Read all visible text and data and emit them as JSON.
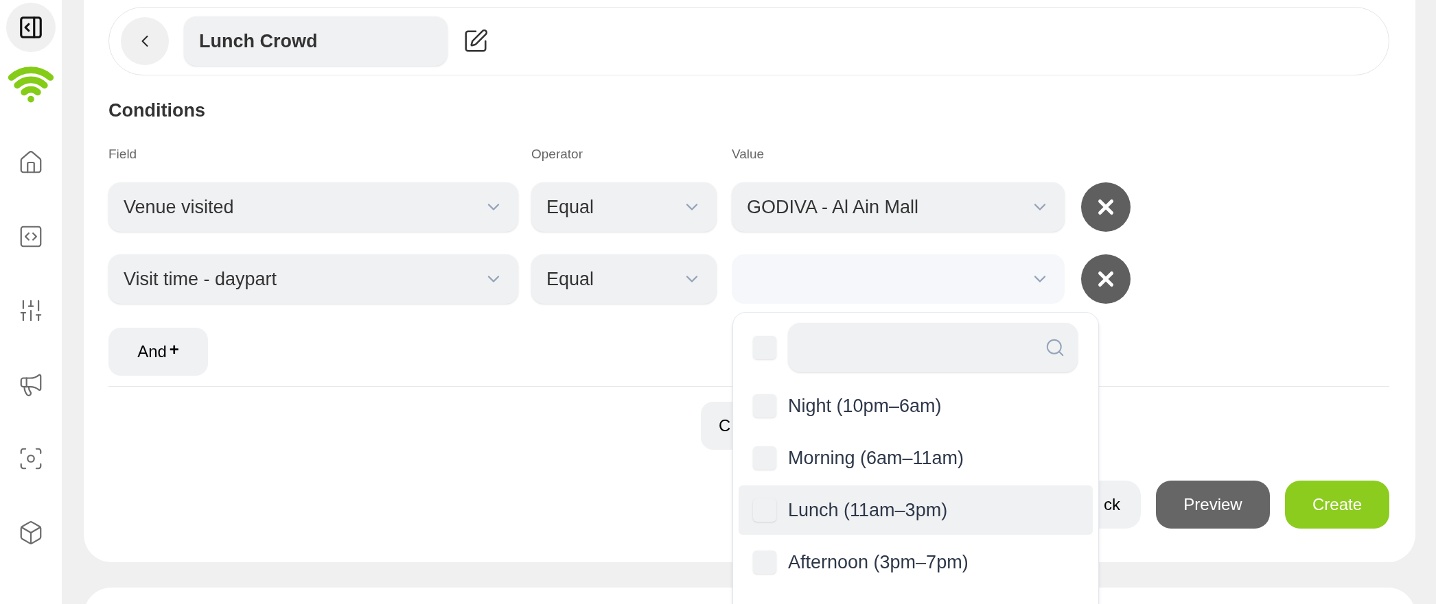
{
  "header": {
    "segment_name": "Lunch Crowd"
  },
  "conditions": {
    "title": "Conditions",
    "columns": [
      "Field",
      "Operator",
      "Value"
    ],
    "rows": [
      {
        "field": "Venue visited",
        "operator": "Equal",
        "value": "GODIVA - Al Ain Mall",
        "open": false
      },
      {
        "field": "Visit time - daypart",
        "operator": "Equal",
        "open": true
      }
    ],
    "add_button": {
      "label": "And",
      "icon": "+"
    }
  },
  "center_button": {
    "label": "C"
  },
  "actions": [
    {
      "label": "ck",
      "kind": "secondary"
    },
    {
      "label": "Preview",
      "kind": "dark"
    },
    {
      "label": "Create",
      "kind": "primary"
    }
  ],
  "dropdown": {
    "select_all_checked": false,
    "options": [
      {
        "label": "Night (10pm–6am)",
        "checked": false,
        "highlighted": false
      },
      {
        "label": "Morning (6am–11am)",
        "checked": false,
        "highlighted": false
      },
      {
        "label": "Lunch (11am–3pm)",
        "checked": false,
        "highlighted": true
      },
      {
        "label": "Afternoon (3pm–7pm)",
        "checked": false,
        "highlighted": false
      }
    ]
  }
}
